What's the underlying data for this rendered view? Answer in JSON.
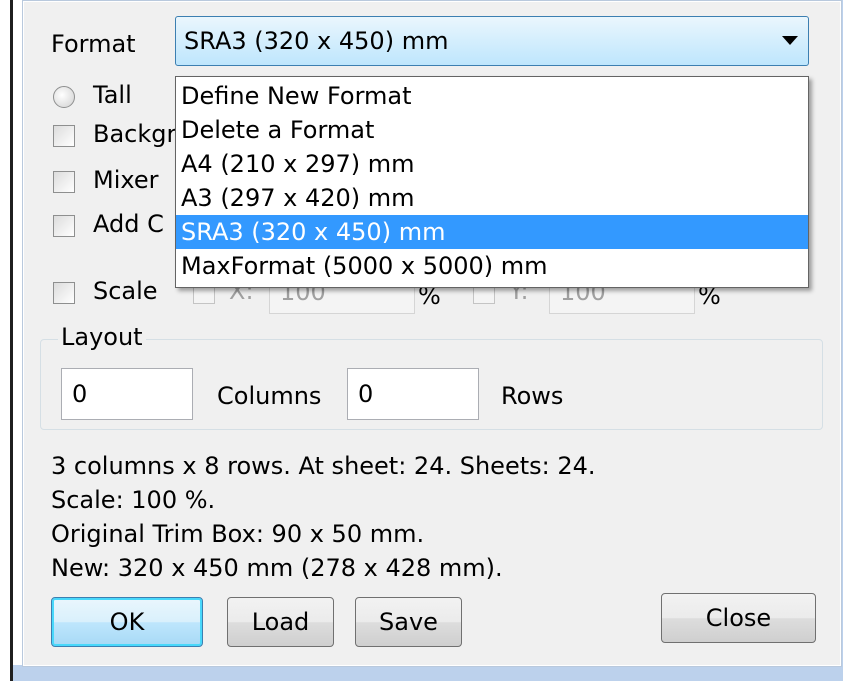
{
  "format": {
    "label": "Format",
    "selected": "SRA3 (320 x 450) mm",
    "options": [
      "Define New Format",
      "Delete a Format",
      "A4 (210 x 297) mm",
      "A3 (297 x 420) mm",
      "SRA3 (320 x 450) mm",
      "MaxFormat (5000 x 5000) mm"
    ],
    "selected_index": 4
  },
  "orientation": {
    "tall_label": "Tall"
  },
  "options": {
    "background_label": "Backgr",
    "mixer_label": "Mixer",
    "add_label": "Add C"
  },
  "scale": {
    "label": "Scale",
    "x_label": "X:",
    "x_value": "100",
    "x_unit": "%",
    "y_label": "Y:",
    "y_value": "100",
    "y_unit": "%"
  },
  "layout": {
    "title": "Layout",
    "columns_value": "0",
    "columns_label": "Columns",
    "rows_value": "0",
    "rows_label": "Rows"
  },
  "info": {
    "line1": "3 columns x 8 rows. At sheet: 24. Sheets: 24.",
    "line2": "Scale: 100 %.",
    "line3": "Original Trim Box: 90 x 50 mm.",
    "line4": "New: 320 x 450 mm (278 x 428 mm)."
  },
  "buttons": {
    "ok": "OK",
    "load": "Load",
    "save": "Save",
    "close": "Close"
  },
  "colors": {
    "highlight": "#3399ff",
    "dialog_bg": "#f0f0f0",
    "frame": "#bcd1ec"
  }
}
